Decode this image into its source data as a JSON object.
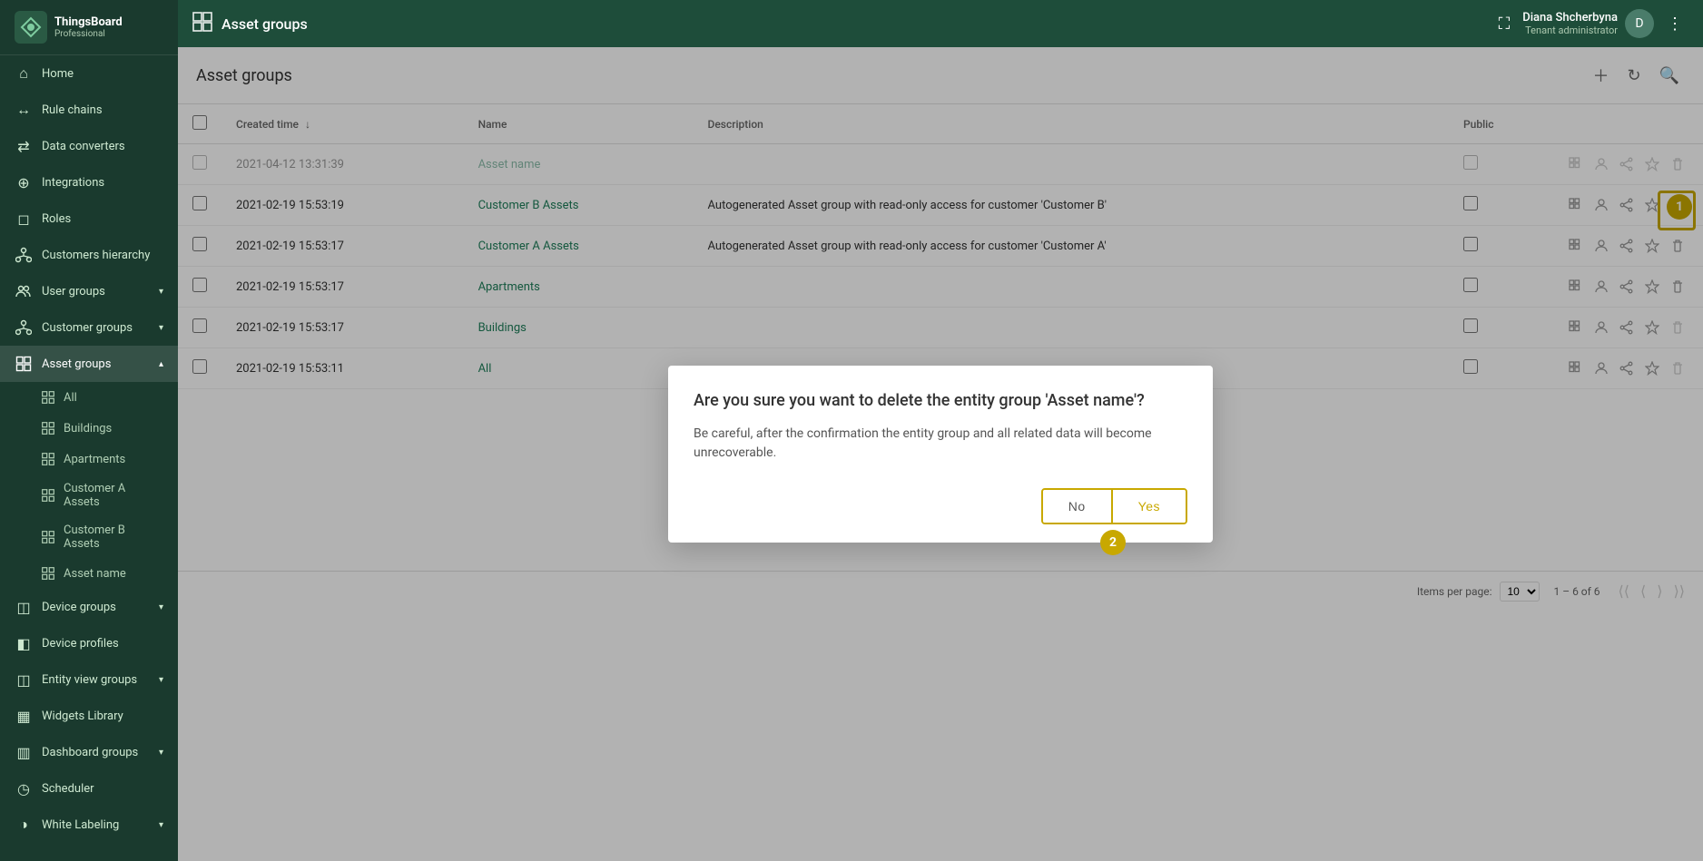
{
  "app": {
    "title": "ThingsBoard",
    "subtitle": "Professional"
  },
  "topbar": {
    "icon": "⊞",
    "title": "Asset groups",
    "user_name": "Diana Shcherbyna",
    "user_role": "Tenant administrator"
  },
  "sidebar": {
    "items": [
      {
        "id": "home",
        "label": "Home",
        "icon": "⌂",
        "active": false
      },
      {
        "id": "rule-chains",
        "label": "Rule chains",
        "icon": "↔",
        "active": false
      },
      {
        "id": "data-converters",
        "label": "Data converters",
        "icon": "⇄",
        "active": false
      },
      {
        "id": "integrations",
        "label": "Integrations",
        "icon": "⊕",
        "active": false
      },
      {
        "id": "roles",
        "label": "Roles",
        "icon": "◻",
        "active": false
      },
      {
        "id": "customers-hierarchy",
        "label": "Customers hierarchy",
        "icon": "◈",
        "active": false
      },
      {
        "id": "user-groups",
        "label": "User groups",
        "icon": "👥",
        "active": false,
        "chevron": "▾"
      },
      {
        "id": "customer-groups",
        "label": "Customer groups",
        "icon": "◈",
        "active": false,
        "chevron": "▾"
      },
      {
        "id": "asset-groups",
        "label": "Asset groups",
        "icon": "⊞",
        "active": true,
        "chevron": "▴"
      },
      {
        "id": "device-groups",
        "label": "Device groups",
        "icon": "◫",
        "active": false,
        "chevron": "▾"
      },
      {
        "id": "device-profiles",
        "label": "Device profiles",
        "icon": "◧",
        "active": false
      },
      {
        "id": "entity-view-groups",
        "label": "Entity view groups",
        "icon": "◫",
        "active": false,
        "chevron": "▾"
      },
      {
        "id": "widgets-library",
        "label": "Widgets Library",
        "icon": "▦",
        "active": false
      },
      {
        "id": "dashboard-groups",
        "label": "Dashboard groups",
        "icon": "▥",
        "active": false,
        "chevron": "▾"
      },
      {
        "id": "scheduler",
        "label": "Scheduler",
        "icon": "◷",
        "active": false
      },
      {
        "id": "white-labeling",
        "label": "White Labeling",
        "icon": "◑",
        "active": false,
        "chevron": "▾"
      }
    ],
    "sub_items": [
      {
        "id": "all",
        "label": "All",
        "active": false
      },
      {
        "id": "buildings",
        "label": "Buildings",
        "active": false
      },
      {
        "id": "apartments",
        "label": "Apartments",
        "active": false
      },
      {
        "id": "customer-a-assets",
        "label": "Customer A Assets",
        "active": false
      },
      {
        "id": "customer-b-assets",
        "label": "Customer B Assets",
        "active": false
      },
      {
        "id": "asset-name",
        "label": "Asset name",
        "active": false
      }
    ]
  },
  "table": {
    "title": "Asset groups",
    "columns": {
      "created_time": "Created time",
      "name": "Name",
      "description": "Description",
      "public": "Public"
    },
    "rows": [
      {
        "id": 1,
        "created_time": "2021-04-12 13:31:39",
        "name": "Asset name",
        "description": "",
        "public": false,
        "is_delete_highlighted": true
      },
      {
        "id": 2,
        "created_time": "2021-02-19 15:53:19",
        "name": "Customer B Assets",
        "description": "Autogenerated Asset group with read-only access for customer 'Customer B'",
        "public": false
      },
      {
        "id": 3,
        "created_time": "2021-02-19 15:53:17",
        "name": "Customer A Assets",
        "description": "Autogenerated Asset group with read-only access for customer 'Customer A'",
        "public": false
      },
      {
        "id": 4,
        "created_time": "2021-02-19 15:53:17",
        "name": "Apartments",
        "description": "",
        "public": false
      },
      {
        "id": 5,
        "created_time": "2021-02-19 15:53:17",
        "name": "Buildings",
        "description": "",
        "public": false
      },
      {
        "id": 6,
        "created_time": "2021-02-19 15:53:11",
        "name": "All",
        "description": "",
        "public": false,
        "last_row": true
      }
    ]
  },
  "pagination": {
    "items_per_page_label": "Items per page:",
    "items_per_page": "10",
    "range": "1 – 6 of 6"
  },
  "dialog": {
    "title": "Are you sure you want to delete the entity group 'Asset name'?",
    "body": "Be careful, after the confirmation the entity group and all related data will become unrecoverable.",
    "no_label": "No",
    "yes_label": "Yes"
  },
  "step_badges": {
    "badge1": "1",
    "badge2": "2"
  },
  "colors": {
    "sidebar_bg": "#1a3a2e",
    "accent": "#c8a800",
    "primary_green": "#1e7e5a"
  }
}
